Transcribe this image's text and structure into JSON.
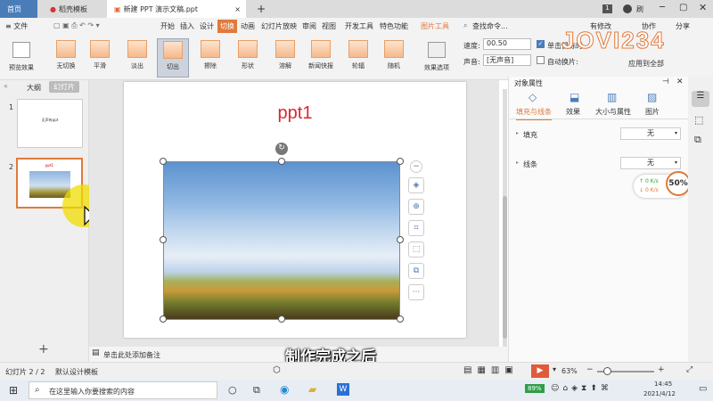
{
  "tabs": {
    "home": "首页",
    "template": "稻壳模板",
    "doc": "新建 PPT 演示文稿.ppt",
    "add": "+"
  },
  "titlebar": {
    "badge": "1",
    "user": "刷"
  },
  "menu": {
    "file": "≡ 文件",
    "items": [
      "开始",
      "插入",
      "设计",
      "切换",
      "动画",
      "幻灯片放映",
      "审阅",
      "视图",
      "开发工具",
      "特色功能"
    ],
    "picture_tools": "图片工具",
    "search": "查找命令...",
    "modified": "有修改",
    "collab": "协作",
    "share": "分享"
  },
  "ribbon": {
    "preview": "预览效果",
    "transitions": [
      "无切换",
      "平滑",
      "淡出",
      "切出",
      "擦除",
      "形状",
      "溶解",
      "新闻快报",
      "轮辐",
      "随机"
    ],
    "options": "效果选项",
    "speed_label": "速度:",
    "speed_value": "00.50",
    "sound_label": "声音:",
    "sound_value": "[无声音]",
    "click_label": "单击鼠标时",
    "auto_label": "自动换片:",
    "apply_all": "应用到全部"
  },
  "left": {
    "outline": "大纲",
    "slides": "幻灯片",
    "thumb1_text": "无声有ppt",
    "thumb2_title": "ppt1",
    "num1": "1",
    "num2": "2"
  },
  "slide": {
    "title": "ppt1"
  },
  "floatbar": {
    "more": "···"
  },
  "right": {
    "header": "对象属性",
    "tabs": [
      "填充与线条",
      "效果",
      "大小与属性",
      "图片"
    ],
    "fill": "填充",
    "fill_value": "无",
    "line": "线条",
    "line_value": "无",
    "speed_up": "0 K/s",
    "speed_down": "0 K/s",
    "percent": "50%"
  },
  "notes": {
    "placeholder": "单击此处添加备注"
  },
  "caption": "制作完成之后",
  "status": {
    "slide_count": "幻灯片 2 / 2",
    "template": "默认设计模板",
    "zoom": "63%"
  },
  "taskbar": {
    "search": "在这里输入你要搜索的内容",
    "battery": "89%",
    "time": "14:45",
    "date": "2021/4/12"
  },
  "watermark": "JOVI234"
}
